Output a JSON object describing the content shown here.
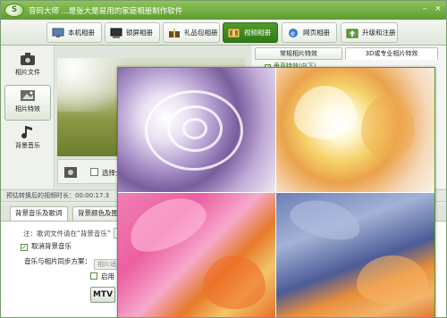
{
  "app": {
    "logo_text": "S",
    "title": "音码大师 ...是张大是易用的家庭相册制作软件",
    "min": "–",
    "close": "×"
  },
  "tabs": [
    {
      "label": "本机相册",
      "icon": "computer-icon"
    },
    {
      "label": "锁屏相册",
      "icon": "monitor-icon"
    },
    {
      "label": "礼品包相册",
      "icon": "gift-icon"
    },
    {
      "label": "视频相册",
      "icon": "film-icon",
      "active": true
    },
    {
      "label": "网页相册",
      "icon": "web-icon"
    },
    {
      "label": "升级和注册",
      "icon": "upgrade-icon"
    }
  ],
  "sidebar": [
    {
      "label": "相片文件",
      "icon": "camera-icon"
    },
    {
      "label": "相片特效",
      "icon": "effects-icon",
      "active": true
    },
    {
      "label": "背景音乐",
      "icon": "music-note-icon"
    }
  ],
  "preview": {
    "checkbox_label": "选择全"
  },
  "right_panel": {
    "tabs": [
      "常规相片特效",
      "3D或专业相片特效"
    ],
    "active_tab": 1,
    "row_label": "垂直特效(向下)"
  },
  "status": {
    "text": "预估转换后的视频时长：00:00:17.3"
  },
  "bottom_tabs": [
    "背景音乐及歌词",
    "背景颜色及图"
  ],
  "bottom_panel": {
    "note": "注：歌词文件请在“背景音乐”",
    "cancel_music": "取消背景音乐",
    "sync_label": "音乐与相片同步方案：",
    "sync_value": "相片适应",
    "enable_label": "启用",
    "mtv_label": "MTV"
  },
  "colors": {
    "brand_green": "#5e9c30",
    "active_tab": "#2f7a18"
  }
}
